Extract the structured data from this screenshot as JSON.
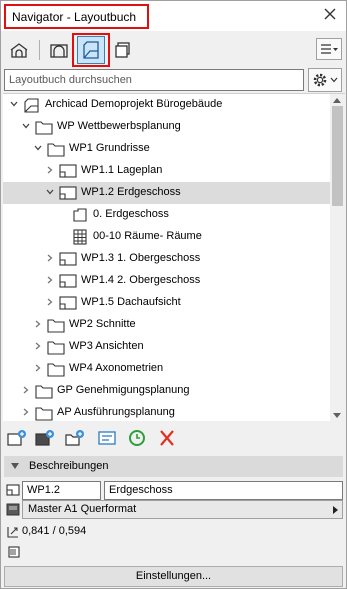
{
  "window": {
    "title": "Navigator - Layoutbuch"
  },
  "search": {
    "placeholder": "Layoutbuch durchsuchen"
  },
  "tree": [
    {
      "label": "Archicad Demoprojekt Bürogebäude",
      "icon": "project-icon",
      "level": 0,
      "expanded": true
    },
    {
      "label": "WP Wettbewerbsplanung",
      "icon": "folder-icon",
      "level": 1,
      "expanded": true
    },
    {
      "label": "WP1 Grundrisse",
      "icon": "folder-icon",
      "level": 2,
      "expanded": true
    },
    {
      "label": "WP1.1 Lageplan",
      "icon": "layout-icon",
      "level": 3,
      "expanded": false
    },
    {
      "label": "WP1.2 Erdgeschoss",
      "icon": "layout-icon",
      "level": 3,
      "expanded": true,
      "selected": true
    },
    {
      "label": "0. Erdgeschoss",
      "icon": "floorplan-view-icon",
      "level": 4
    },
    {
      "label": "00-10 Räume- Räume",
      "icon": "table-icon",
      "level": 4
    },
    {
      "label": "WP1.3 1. Obergeschoss",
      "icon": "layout-icon",
      "level": 3,
      "expanded": false
    },
    {
      "label": "WP1.4 2. Obergeschoss",
      "icon": "layout-icon",
      "level": 3,
      "expanded": false
    },
    {
      "label": "WP1.5 Dachaufsicht",
      "icon": "layout-icon",
      "level": 3,
      "expanded": false
    },
    {
      "label": "WP2 Schnitte",
      "icon": "folder-icon",
      "level": 2,
      "expanded": false
    },
    {
      "label": "WP3 Ansichten",
      "icon": "folder-icon",
      "level": 2,
      "expanded": false
    },
    {
      "label": "WP4 Axonometrien",
      "icon": "folder-icon",
      "level": 2,
      "expanded": false
    },
    {
      "label": "GP Genehmigungsplanung",
      "icon": "folder-icon",
      "level": 1,
      "expanded": false
    },
    {
      "label": "AP Ausführungsplanung",
      "icon": "folder-icon",
      "level": 1,
      "expanded": false
    }
  ],
  "section": {
    "label": "Beschreibungen"
  },
  "details": {
    "id": "WP1.2",
    "name": "Erdgeschoss",
    "master": "Master A1 Querformat",
    "size": "0,841 / 0,594"
  },
  "settings_button": "Einstellungen...",
  "colors": {
    "highlight": "#e01010",
    "active_button": "#cce4f7",
    "selection": "#dcdcdc"
  }
}
